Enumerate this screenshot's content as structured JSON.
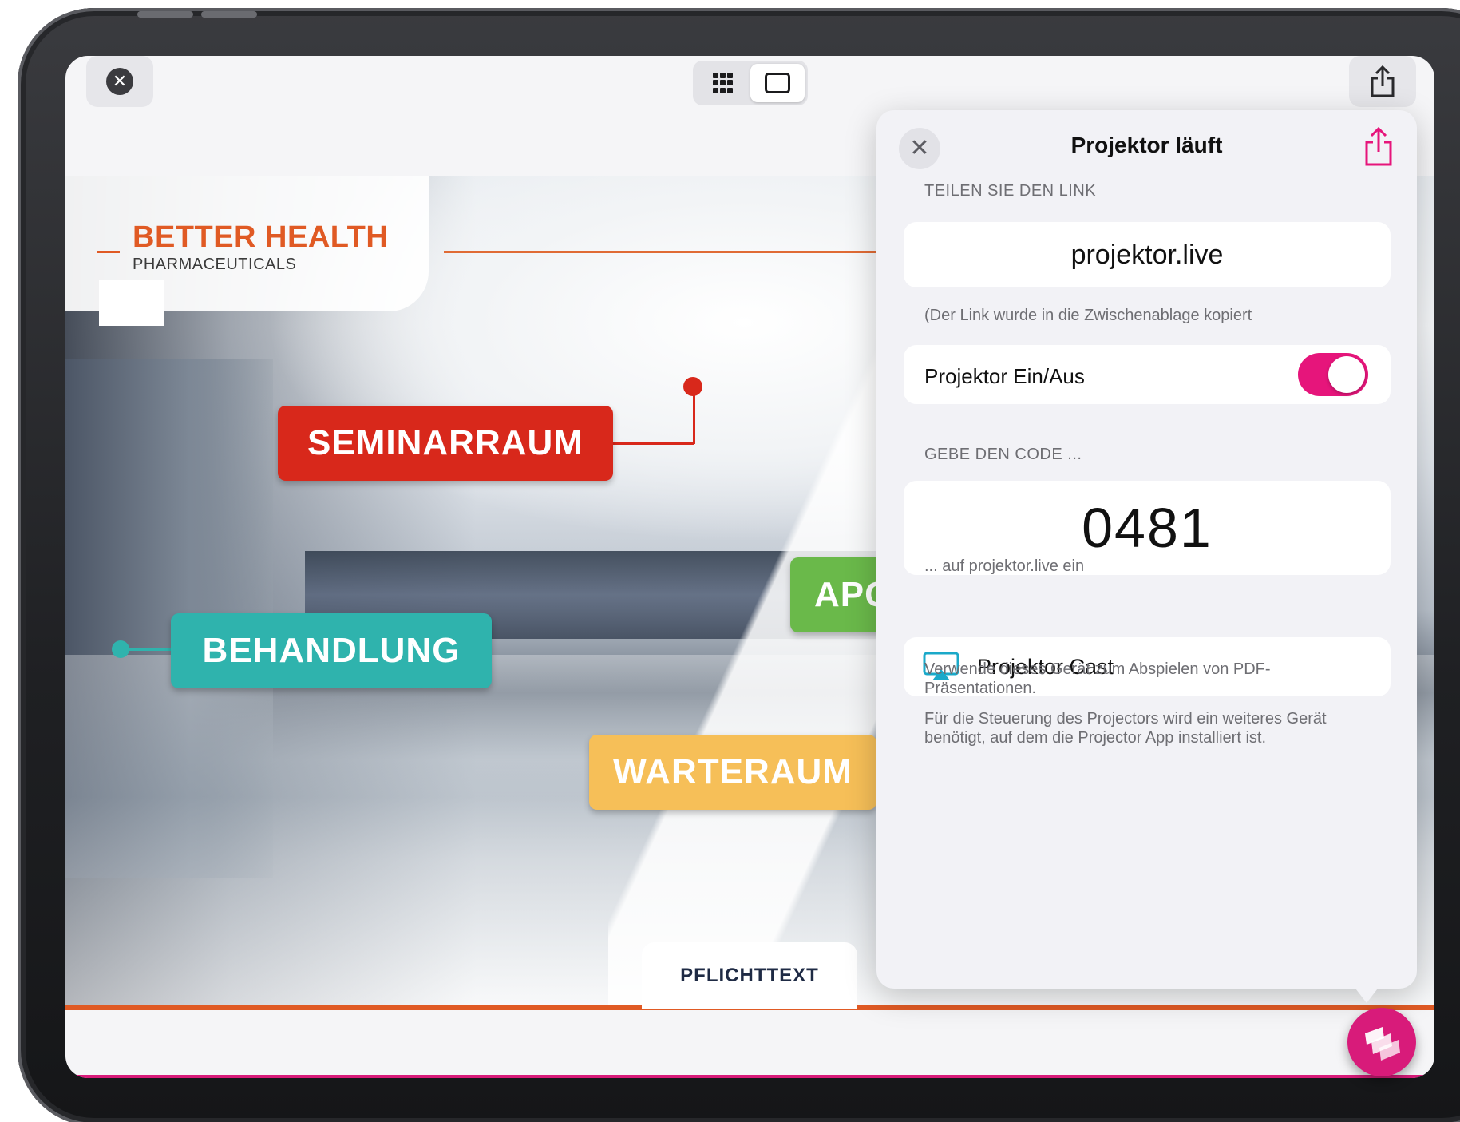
{
  "toolbar": {
    "close_icon": "close-icon",
    "view_modes": [
      {
        "name": "grid-view",
        "icon": "grid-icon",
        "active": false
      },
      {
        "name": "single-view",
        "icon": "single-slide-icon",
        "active": true
      }
    ],
    "share_icon": "share-icon"
  },
  "slide": {
    "logo_title": "BETTER HEALTH",
    "logo_subtitle": "PHARMACEUTICALS",
    "tags": {
      "seminar": "SEMINARRAUM",
      "behandlung": "BEHANDLUNG",
      "warteraum": "WARTERAUM",
      "apo": "APO"
    },
    "footer_tab": "PFLICHTTEXT"
  },
  "panel": {
    "title": "Projektor läuft",
    "share_label": "TEILEN SIE DEN LINK",
    "link": "projektor.live",
    "link_hint": "(Der Link wurde in die Zwischenablage kopiert",
    "toggle_label": "Projektor Ein/Aus",
    "toggle_on": true,
    "code_label": "GEBE DEN CODE ...",
    "code": "0481",
    "code_hint": "... auf projektor.live ein",
    "cast_label": "Projektor Cast",
    "cast_desc_1": "Verwende dieses Gerät zum Abspielen von PDF-Präsentationen.",
    "cast_desc_2": "Für die Steuerung des Projectors wird ein weiteres Gerät benötigt, auf dem die Projector App installiert ist."
  },
  "colors": {
    "accent": "#e6157b",
    "brand_orange": "#e05a24",
    "tag_red": "#d8281b",
    "tag_teal": "#2fb3ad",
    "tag_yellow": "#f6bf58",
    "tag_green": "#6ab94a"
  }
}
